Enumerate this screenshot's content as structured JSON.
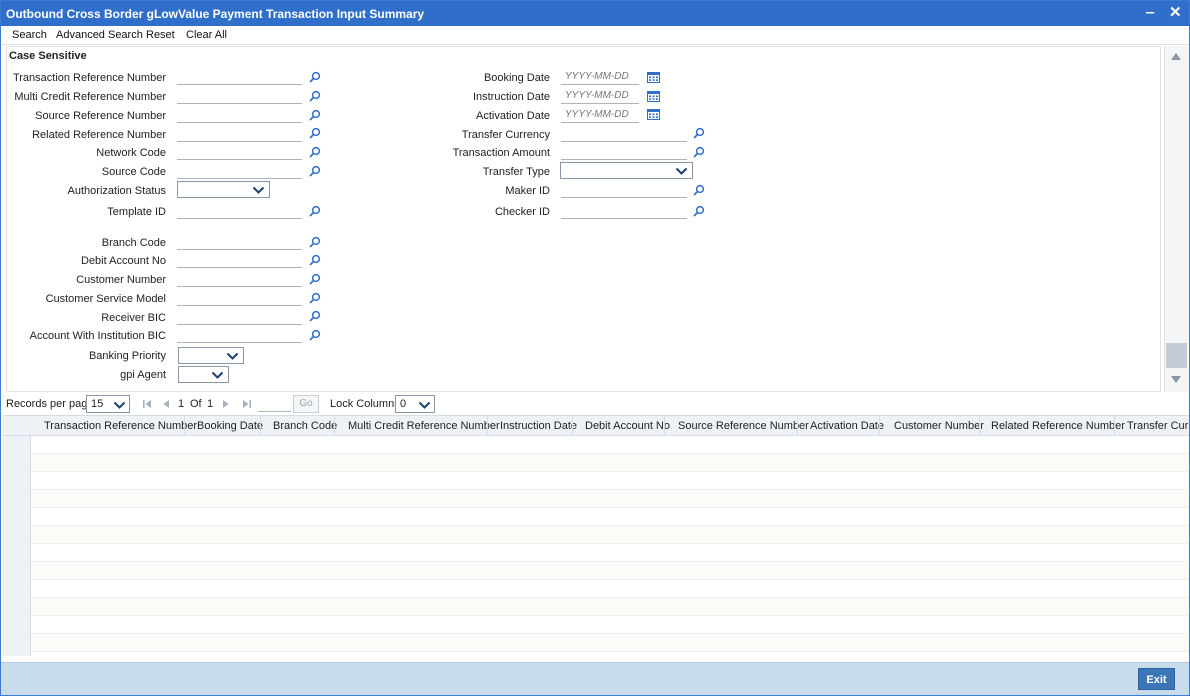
{
  "window": {
    "title": "Outbound Cross Border gLowValue Payment Transaction Input Summary",
    "minimize_glyph": "‒",
    "close_glyph": "✕"
  },
  "menu": {
    "search": "Search",
    "advanced_search": "Advanced Search",
    "reset": "Reset",
    "clear_all": "Clear All"
  },
  "form": {
    "section_title": "Case Sensitive",
    "left_fields": {
      "transaction_reference_number": "Transaction Reference Number",
      "multi_credit_reference_number": "Multi Credit Reference Number",
      "source_reference_number": "Source Reference Number",
      "related_reference_number": "Related Reference Number",
      "network_code": "Network Code",
      "source_code": "Source Code",
      "authorization_status": "Authorization Status",
      "template_id": "Template ID",
      "branch_code": "Branch Code",
      "debit_account_no": "Debit Account No",
      "customer_number": "Customer Number",
      "customer_service_model": "Customer Service Model",
      "receiver_bic": "Receiver BIC",
      "account_with_institution_bic": "Account With Institution BIC",
      "banking_priority": "Banking Priority",
      "gpi_agent": "gpi Agent"
    },
    "right_fields": {
      "booking_date": "Booking Date",
      "instruction_date": "Instruction Date",
      "activation_date": "Activation Date",
      "transfer_currency": "Transfer Currency",
      "transaction_amount": "Transaction Amount",
      "transfer_type": "Transfer Type",
      "maker_id": "Maker ID",
      "checker_id": "Checker ID"
    },
    "date_placeholder": "YYYY-MM-DD"
  },
  "pager": {
    "records_per_page_label": "Records per page",
    "records_per_page_value": "15",
    "current_page": "1",
    "of_label": "Of",
    "total_pages": "1",
    "go_label": "Go",
    "lock_columns_label": "Lock Columns",
    "lock_columns_value": "0"
  },
  "grid": {
    "columns": [
      "Transaction Reference Number",
      "Booking Date",
      "Branch Code",
      "Multi Credit Reference Number",
      "Instruction Date",
      "Debit Account No",
      "Source Reference Number",
      "Activation Date",
      "Customer Number",
      "Related Reference Number",
      "Transfer Cur"
    ],
    "rows": []
  },
  "footer": {
    "exit_label": "Exit"
  },
  "colors": {
    "titlebar": "#2f6fc9",
    "footer": "#c9dced",
    "exit_button": "#3b76b8",
    "icon_blue": "#2f6fc9"
  }
}
